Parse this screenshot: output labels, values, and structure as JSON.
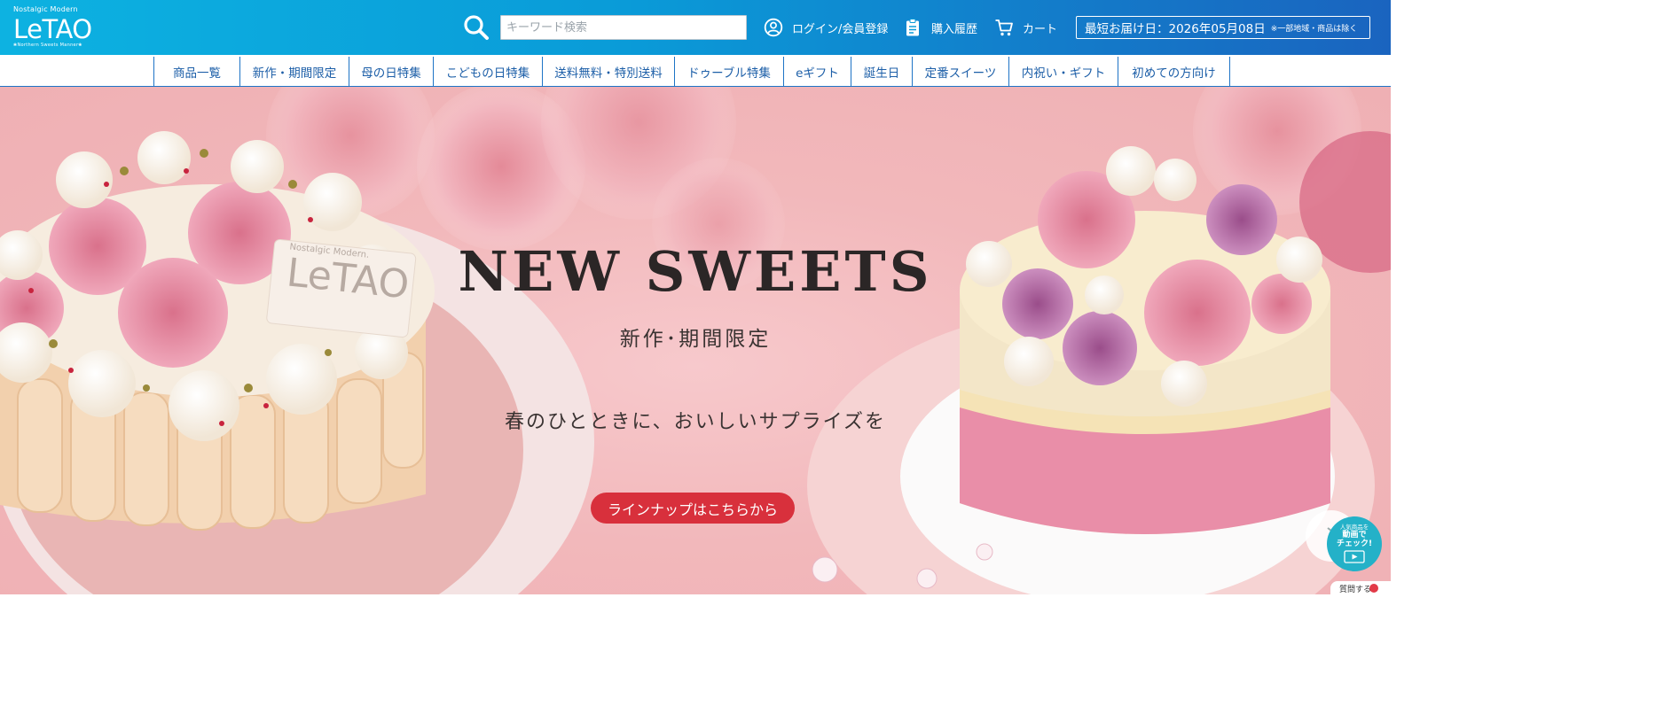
{
  "header": {
    "logo": {
      "top": "Nostalgic Modern",
      "main": "LeTAO",
      "sub": "❀Northern Sweets Manner❀"
    },
    "search": {
      "placeholder": "キーワード検索",
      "value": ""
    },
    "login_label": "ログイン/会員登録",
    "history_label": "購入履歴",
    "cart_label": "カート",
    "delivery": {
      "main": "最短お届け日：2026年05月08日",
      "note": "※一部地域・商品は除く"
    }
  },
  "nav": {
    "items": [
      {
        "label": "商品一覧"
      },
      {
        "label": "新作・期間限定"
      },
      {
        "label": "母の日特集"
      },
      {
        "label": "こどもの日特集"
      },
      {
        "label": "送料無料・特別送料"
      },
      {
        "label": "ドゥーブル特集"
      },
      {
        "label": "eギフト"
      },
      {
        "label": "誕生日"
      },
      {
        "label": "定番スイーツ"
      },
      {
        "label": "内祝い・ギフト"
      },
      {
        "label": "初めての方向け"
      }
    ]
  },
  "hero": {
    "title": "NEW SWEETS",
    "subtitle": "新作･期間限定",
    "tagline": "春のひとときに、おいしいサプライズを",
    "cta": "ラインナップはこちらから",
    "plate_logo_top": "Nostalgic Modern.",
    "plate_logo_main": "LeTAO"
  },
  "widgets": {
    "video": {
      "line1": "人気商品を",
      "line2": "動画で",
      "line3": "チェック!"
    },
    "question_label": "質問する"
  },
  "colors": {
    "header_start": "#0db2e1",
    "header_end": "#1a64bf",
    "nav_text": "#1d5fa8",
    "cta": "#d8303c",
    "video_widget": "#24b1c8"
  },
  "icons": {
    "search": "magnifier-icon",
    "login": "user-circle-icon",
    "history": "clipboard-icon",
    "cart": "cart-icon"
  }
}
